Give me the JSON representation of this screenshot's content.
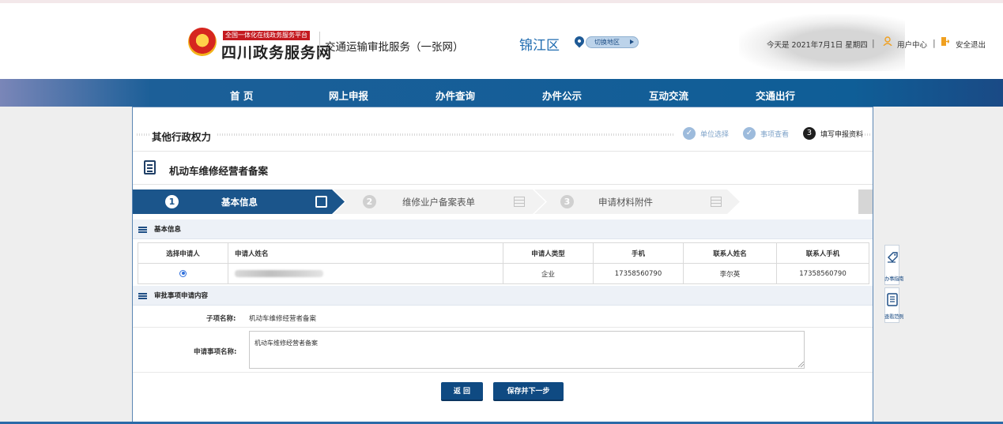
{
  "header": {
    "platform_tag": "全国一体化在线政务服务平台",
    "brand": "四川政务服务网",
    "service_title": "交通运输审批服务（一张网）",
    "region": "锦江区",
    "switch_region": "切换地区",
    "date_text": "今天是 2021年7月1日 星期四",
    "separator": "|",
    "user_center": "用户中心",
    "logout": "安全退出"
  },
  "nav": {
    "items": [
      "首 页",
      "网上申报",
      "办件查询",
      "办件公示",
      "互动交流",
      "交通出行"
    ]
  },
  "breadcrumb": {
    "title": "其他行政权力",
    "steps": [
      {
        "num": "✓",
        "label": "单位选择"
      },
      {
        "num": "✓",
        "label": "事项查看"
      },
      {
        "num": "3",
        "label": "填写申报资料"
      }
    ]
  },
  "item": {
    "title": "机动车维修经营者备案"
  },
  "wizard": {
    "steps": [
      {
        "num": "1",
        "label": "基本信息"
      },
      {
        "num": "2",
        "label": "维修业户备案表单"
      },
      {
        "num": "3",
        "label": "申请材料附件"
      }
    ]
  },
  "basic_info": {
    "section_title": "基本信息",
    "columns": [
      "选择申请人",
      "申请人姓名",
      "申请人类型",
      "手机",
      "联系人姓名",
      "联系人手机"
    ],
    "row": {
      "type": "企业",
      "phone": "17358560790",
      "contact_name": "李尔英",
      "contact_phone": "17358560790"
    }
  },
  "application": {
    "section_title": "审批事项申请内容",
    "sub_item_label": "子项名称:",
    "sub_item_value": "机动车维修经营者备案",
    "item_name_label": "申请事项名称:",
    "item_name_value": "机动车维修经营者备案"
  },
  "buttons": {
    "back": "返 回",
    "save_next": "保存并下一步"
  },
  "side_tools": {
    "guide": "办事指南",
    "example": "查看范例"
  },
  "colors": {
    "nav_bg": "#0f5e97",
    "primary": "#1b558b",
    "button": "#0f4a82",
    "region_text": "#1e6bb0",
    "page_bg": "#eeeeee"
  }
}
